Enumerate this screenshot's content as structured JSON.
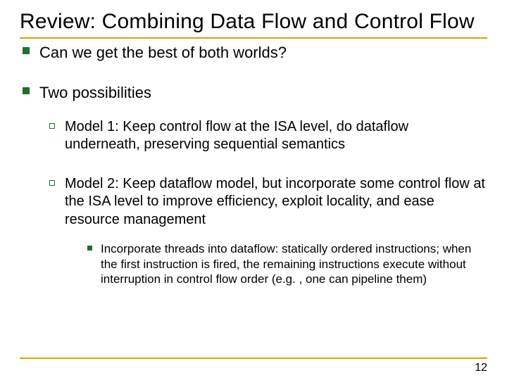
{
  "title": "Review: Combining Data Flow and Control Flow",
  "bullets": {
    "item1": "Can we get the best of both worlds?",
    "item2": "Two possibilities",
    "sub1": "Model 1: Keep control flow at the ISA level, do dataflow underneath, preserving sequential semantics",
    "sub2": "Model 2: Keep dataflow model, but incorporate some control flow at the ISA level to improve efficiency, exploit locality, and ease resource management",
    "subsub1": "Incorporate threads into dataflow: statically ordered instructions; when the first instruction is fired, the remaining instructions execute without interruption in control flow order (e.g. , one can pipeline them)"
  },
  "page_number": "12"
}
